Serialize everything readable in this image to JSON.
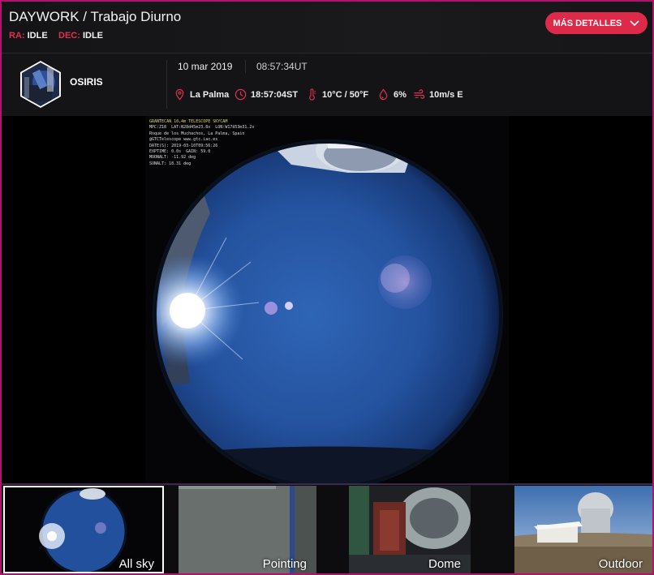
{
  "header": {
    "title": "DAYWORK / Trabajo Diurno",
    "ra_label": "RA:",
    "ra_value": "IDLE",
    "dec_label": "DEC:",
    "dec_value": "IDLE",
    "details_button": "MÁS DETALLES"
  },
  "instrument": {
    "name": "OSIRIS"
  },
  "info": {
    "date": "10 mar 2019",
    "ut": "08:57:34UT",
    "location": "La Palma",
    "sidereal": "18:57:04ST",
    "temperature": "10°C / 50°F",
    "humidity": "6%",
    "wind": "10m/s E"
  },
  "skycam_caption": {
    "line1": "GRANTECAN 10,4m TELESCOPE SKYCAM",
    "line2": "MPC:Z18  LAT:N28d45m23.8s  LON:W17d53m31.2s",
    "line3": "Roque de los Muchachos, La Palma, Spain",
    "line4": "@GTCTelescope www.gtc.iac.es",
    "line5": "DATE(S): 2019-03-10T09:56:26",
    "line6": "EXPTIME: 0.0s  GAIN: 59.0",
    "line7": "MOONALT: -11.92 deg",
    "line8": "SUNALT: 18.31 deg"
  },
  "thumbnails": [
    {
      "label": "All sky",
      "active": true
    },
    {
      "label": "Pointing",
      "active": false
    },
    {
      "label": "Dome",
      "active": false
    },
    {
      "label": "Outdoor",
      "active": false
    }
  ],
  "colors": {
    "accent": "#dd2a49",
    "border": "#b0126e"
  },
  "icons": [
    "chevron-down-icon",
    "location-pin-icon",
    "clock-icon",
    "thermometer-icon",
    "humidity-drop-icon",
    "wind-icon"
  ]
}
